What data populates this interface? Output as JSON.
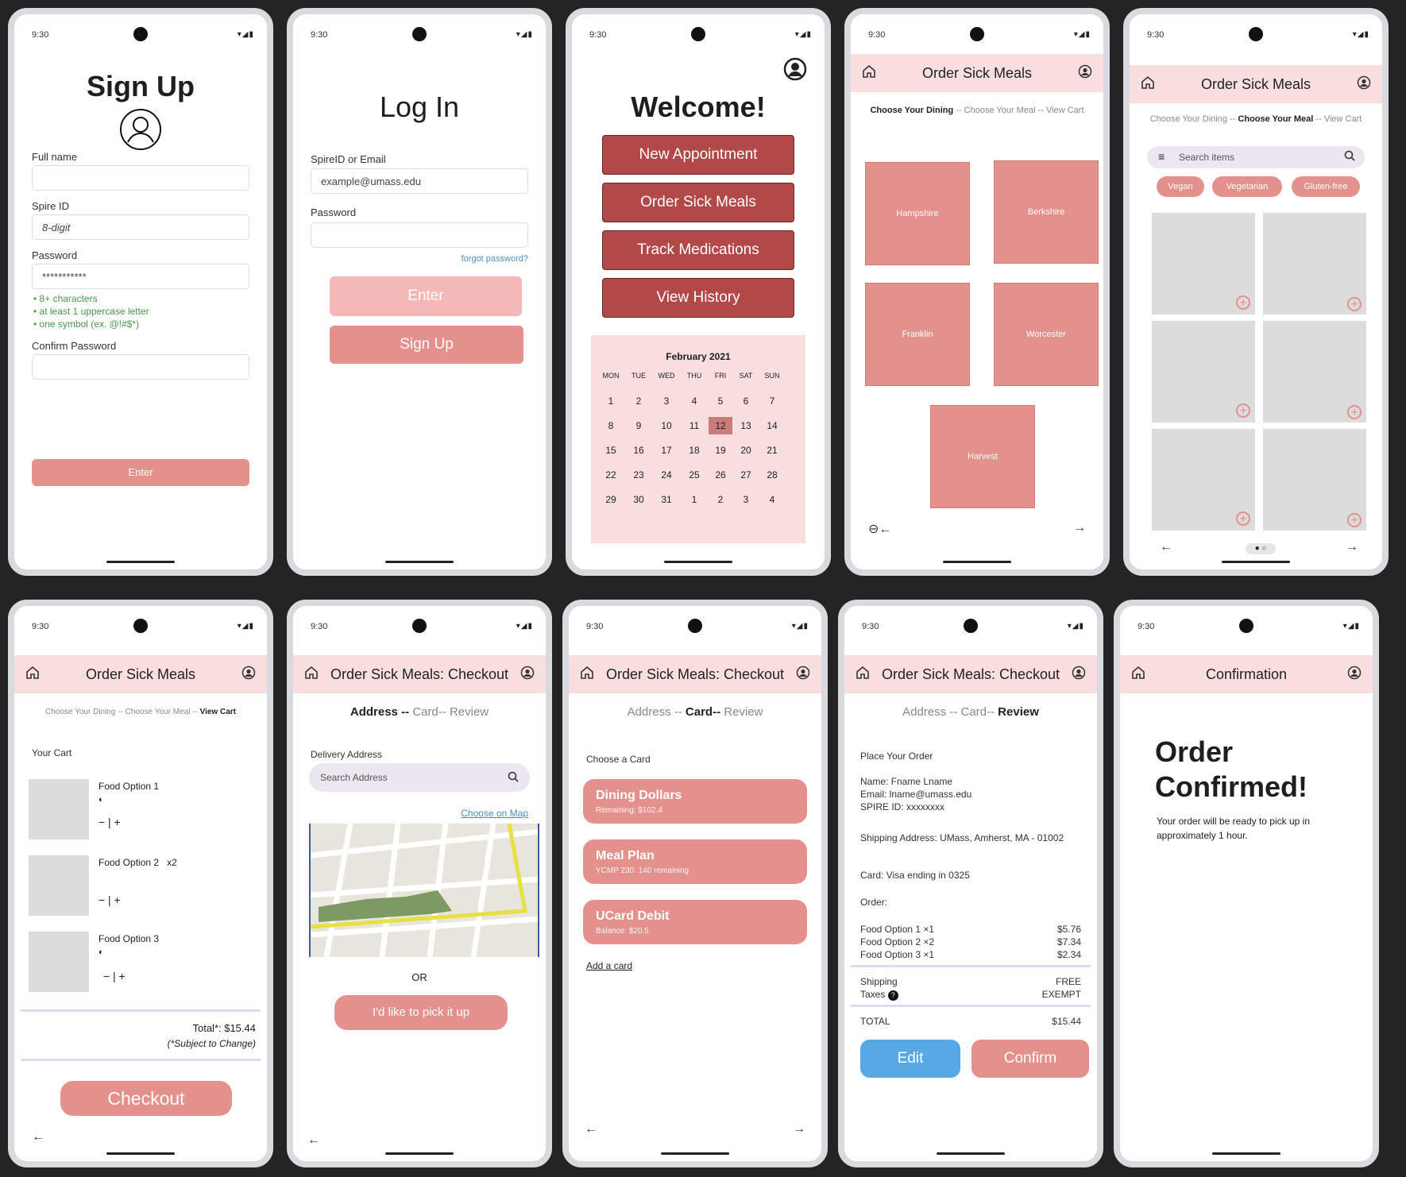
{
  "status": {
    "time": "9:30"
  },
  "signup": {
    "title": "Sign Up",
    "full_name_label": "Full name",
    "spire_label": "Spire ID",
    "spire_placeholder": "8-digit",
    "password_label": "Password",
    "password_value": "***********",
    "rules": [
      "8+ characters",
      "at least 1 uppercase letter",
      "one symbol (ex. @!#$*)"
    ],
    "confirm_label": "Confirm Password",
    "enter_label": "Enter"
  },
  "login": {
    "title": "Log In",
    "id_label": "SpireID or Email",
    "id_value": "example@umass.edu",
    "password_label": "Password",
    "forgot": "forgot password?",
    "enter_label": "Enter",
    "signup_label": "Sign Up"
  },
  "welcome": {
    "title": "Welcome!",
    "buttons": [
      "New Appointment",
      "Order Sick Meals",
      "Track Medications",
      "View History"
    ],
    "calendar": {
      "month": "February 2021",
      "days": [
        "MON",
        "TUE",
        "WED",
        "THU",
        "FRI",
        "SAT",
        "SUN"
      ],
      "weeks": [
        [
          "1",
          "2",
          "3",
          "4",
          "5",
          "6",
          "7"
        ],
        [
          "8",
          "9",
          "10",
          "11",
          "12",
          "13",
          "14"
        ],
        [
          "15",
          "16",
          "17",
          "18",
          "19",
          "20",
          "21"
        ],
        [
          "22",
          "23",
          "24",
          "25",
          "26",
          "27",
          "28"
        ],
        [
          "29",
          "30",
          "31",
          "1",
          "2",
          "3",
          "4"
        ]
      ],
      "selected": "12"
    }
  },
  "dining": {
    "title": "Order Sick Meals",
    "bread": [
      "Choose Your Dining",
      "Choose Your Meal",
      "View Cart"
    ],
    "halls": [
      "Hampshire",
      "Berkshire",
      "Franklin",
      "Worcester",
      "Harvest"
    ]
  },
  "meal": {
    "title": "Order Sick Meals",
    "bread": [
      "Choose Your Dining",
      "Choose Your Meal",
      "View Cart"
    ],
    "search_placeholder": "Search items",
    "filters": [
      "Vegan",
      "Vegetarian",
      "Gluten-free"
    ]
  },
  "cart": {
    "title": "Order Sick Meals",
    "bread": [
      "Choose Your Dining",
      "Choose Your Meal",
      "View Cart"
    ],
    "heading": "Your Cart",
    "items": [
      {
        "name": "Food Option 1",
        "qty": ""
      },
      {
        "name": "Food Option 2",
        "qty": "x2"
      },
      {
        "name": "Food Option 3",
        "qty": ""
      }
    ],
    "total": "Total*: $15.44",
    "note": "(*Subject to Change)",
    "checkout": "Checkout"
  },
  "address": {
    "title": "Order Sick Meals: Checkout",
    "steps": [
      "Address",
      "Card",
      "Review"
    ],
    "delivery_label": "Delivery Address",
    "search_placeholder": "Search Address",
    "choose_map": "Choose on Map",
    "or": "OR",
    "pickup": "I'd like to pick it up"
  },
  "cards": {
    "title": "Order Sick Meals: Checkout",
    "steps": [
      "Address",
      "Card",
      "Review"
    ],
    "heading": "Choose a Card",
    "options": [
      {
        "name": "Dining Dollars",
        "sub": "Remaining: $102.4"
      },
      {
        "name": "Meal Plan",
        "sub": "YCMP 230: 140 remaining"
      },
      {
        "name": "UCard Debit",
        "sub": "Balance: $20.5"
      }
    ],
    "add": "Add a card"
  },
  "review": {
    "title": "Order Sick Meals: Checkout",
    "steps": [
      "Address",
      "Card",
      "Review"
    ],
    "heading": "Place Your Order",
    "name": "Name: Fname Lname",
    "email": "Email: lname@umass.edu",
    "spire": "SPIRE ID: xxxxxxxx",
    "shipping_address": "Shipping Address: UMass, Amherst, MA - 01002",
    "card": "Card: Visa ending in 0325",
    "order_label": "Order:",
    "lines": [
      {
        "item": "Food Option 1 ×1",
        "price": "$5.76"
      },
      {
        "item": "Food Option 2 ×2",
        "price": "$7.34"
      },
      {
        "item": "Food Option 3 ×1",
        "price": "$2.34"
      }
    ],
    "shipping": "Shipping",
    "shipping_val": "FREE",
    "taxes": "Taxes",
    "taxes_val": "EXEMPT",
    "total": "TOTAL",
    "total_val": "$15.44",
    "edit": "Edit",
    "confirm": "Confirm"
  },
  "confirmation": {
    "title": "Confirmation",
    "heading": "Order Confirmed!",
    "message": "Your order will be ready to pick up in approximately 1 hour."
  },
  "colors": {
    "pink": "#e4908c",
    "red": "#b34848",
    "appbar": "#f8dede",
    "blue": "#58a8e6"
  }
}
